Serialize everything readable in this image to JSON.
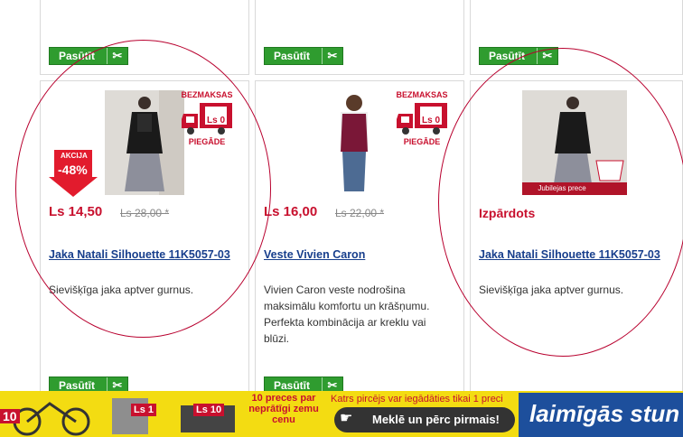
{
  "order_button": {
    "label": "Pasūtīt"
  },
  "products": [
    {
      "badge_label": "AKCIJA",
      "badge_value": "-48%",
      "free_shipping_top": "BEZMAKSAS",
      "free_shipping_bottom": "PIEGĀDE",
      "free_shipping_price": "Ls 0",
      "price": "Ls 14,50",
      "old_price": "Ls 28,00 *",
      "title": "Jaka Natali Silhouette 11K5057-03",
      "description": "Sievišķīga jaka aptver gurnus."
    },
    {
      "free_shipping_top": "BEZMAKSAS",
      "free_shipping_bottom": "PIEGĀDE",
      "free_shipping_price": "Ls 0",
      "price": "Ls 16,00",
      "old_price": "Ls 22,00 *",
      "title": "Veste Vivien Caron",
      "description": "Vivien Caron veste nodrošina maksimālu komfortu un krāšņumu. Perfekta kombinācija ar kreklu vai blūzi."
    },
    {
      "image_caption": "Jubilejas prece",
      "sale_label": "Izpārdots",
      "title": "Jaka Natali Silhouette 11K5057-03",
      "description": "Sievišķīga jaka aptver gurnus."
    }
  ],
  "banner": {
    "preces_text": "10 preces par neprātīgi zemu cenu",
    "notice": "Katrs pircējs var iegādāties tikai 1 preci",
    "cta": "Meklē un pērc pirmais!",
    "brand": "laimīgās stun",
    "price_tag_1": "Ls 1",
    "price_tag_10": "Ls 10",
    "price_tag_left": "10"
  },
  "colors": {
    "accent_red": "#c8102e",
    "button_green": "#2f9c2f",
    "link_blue": "#173e8c",
    "banner_yellow": "#f3dc12"
  }
}
